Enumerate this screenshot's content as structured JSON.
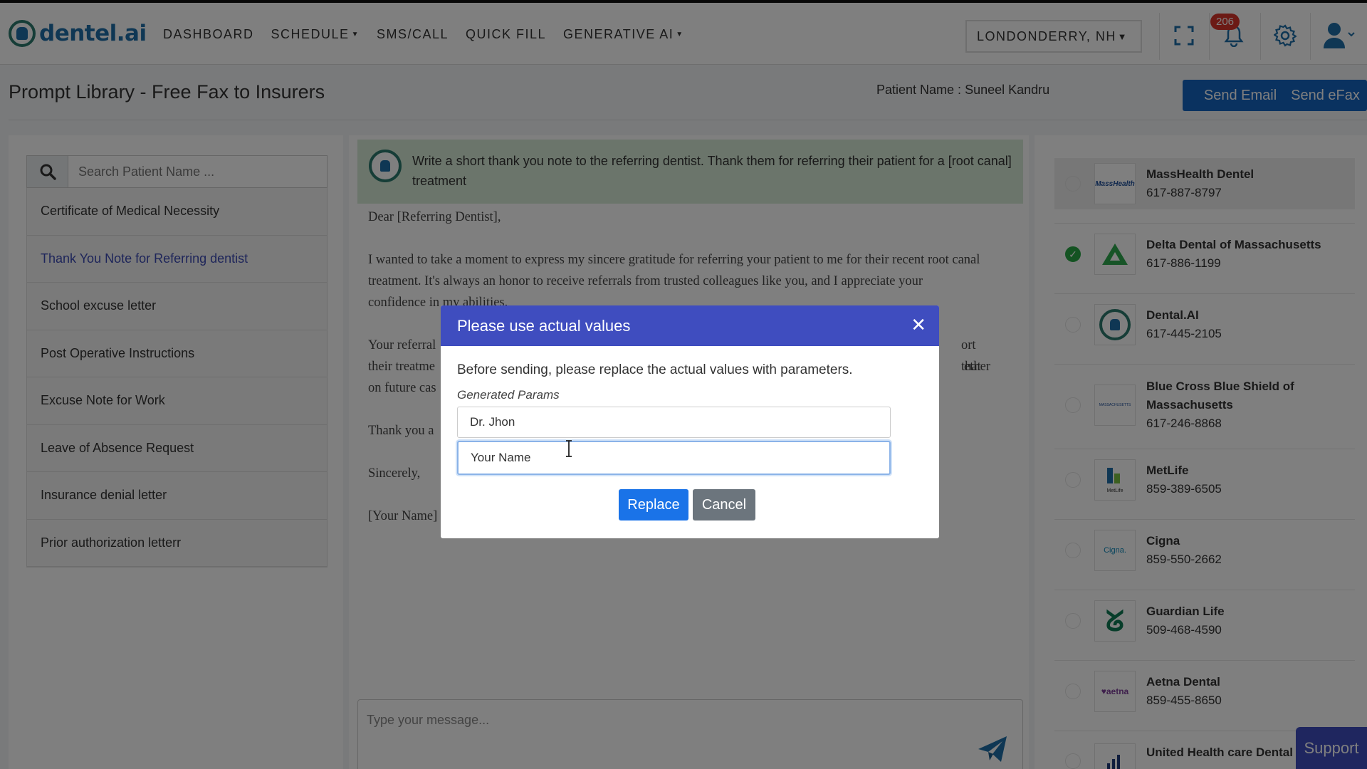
{
  "app": {
    "logo_text": "dentel.ai",
    "logo_icon": "tooth-logo-icon"
  },
  "nav": [
    {
      "label": "DASHBOARD",
      "dropdown": false
    },
    {
      "label": "SCHEDULE",
      "dropdown": true
    },
    {
      "label": "SMS/CALL",
      "dropdown": false
    },
    {
      "label": "QUICK FILL",
      "dropdown": false
    },
    {
      "label": "GENERATIVE AI",
      "dropdown": true
    }
  ],
  "header": {
    "location": "LONDONDERRY, NH",
    "notification_count": "206",
    "icons": [
      "fullscreen-icon",
      "bell-icon",
      "gear-icon",
      "user-icon"
    ]
  },
  "page": {
    "title": "Prompt Library - Free Fax to Insurers",
    "patient_label": "Patient Name :",
    "patient_name": "Suneel Kandru",
    "send_email": "Send Email",
    "send_efax": "Send eFax"
  },
  "sidebar": {
    "search_placeholder": "Search Patient Name ...",
    "items": [
      {
        "label": "Certificate of Medical Necessity",
        "active": false
      },
      {
        "label": "Thank You Note for Referring dentist",
        "active": true
      },
      {
        "label": "School excuse letter",
        "active": false
      },
      {
        "label": "Post Operative Instructions",
        "active": false
      },
      {
        "label": "Excuse Note for Work",
        "active": false
      },
      {
        "label": "Leave of Absence Request",
        "active": false
      },
      {
        "label": "Insurance denial letter",
        "active": false
      },
      {
        "label": "Prior authorization letterr",
        "active": false
      }
    ]
  },
  "center": {
    "prompt": "Write a short thank you note to the referring dentist. Thank them for referring their patient for a [root canal] treatment",
    "letter": {
      "greeting": "Dear [Referring Dentist],",
      "p1": "I wanted to take a moment to express my sincere gratitude for referring your patient to me for their recent root canal treatment. It's always an honor to receive referrals from trusted colleagues like you, and I appreciate your confidence in my abilities.",
      "p2_start": "Your referral",
      "p2_mid_right": "ort that",
      "p2_line2_start": "their treatme",
      "p2_line2_right": "ether",
      "p2_line3_start": "on future cas",
      "p3_start": "Thank you a",
      "closing": "Sincerely,",
      "signature": "[Your Name]"
    },
    "message_placeholder": "Type your message..."
  },
  "insurers": [
    {
      "name": "MassHealth Dentel",
      "phone": "617-887-8797",
      "selected": false,
      "highlight": true,
      "logo": "masshealth-logo-icon"
    },
    {
      "name": "Delta Dental of Massachusetts",
      "phone": "617-886-1199",
      "selected": true,
      "highlight": false,
      "logo": "delta-logo-icon"
    },
    {
      "name": "Dental.AI",
      "phone": "617-445-2105",
      "selected": false,
      "highlight": false,
      "logo": "tooth-logo-icon"
    },
    {
      "name": "Blue Cross Blue Shield of",
      "name2": "Massachusetts",
      "phone": "617-246-8868",
      "selected": false,
      "highlight": false,
      "logo": "bcbs-logo-icon"
    },
    {
      "name": "MetLife",
      "phone": "859-389-6505",
      "selected": false,
      "highlight": false,
      "logo": "metlife-logo-icon"
    },
    {
      "name": "Cigna",
      "phone": "859-550-2662",
      "selected": false,
      "highlight": false,
      "logo": "cigna-logo-icon"
    },
    {
      "name": "Guardian Life",
      "phone": "509-468-4590",
      "selected": false,
      "highlight": false,
      "logo": "guardian-logo-icon"
    },
    {
      "name": "Aetna Dental",
      "phone": "859-455-8650",
      "selected": false,
      "highlight": false,
      "logo": "aetna-logo-icon"
    },
    {
      "name": "United Health care Dental",
      "phone": "",
      "selected": false,
      "highlight": false,
      "logo": "united-logo-icon"
    }
  ],
  "logo_texts": {
    "masshealth": "MassHealth",
    "aetna": "♥aetna",
    "cigna": "Cigna.",
    "metlife": "MetLife",
    "bcbs": "MASSACHUSETTS"
  },
  "support_label": "Support",
  "modal": {
    "title": "Please use actual values",
    "message": "Before sending, please replace the actual values with parameters.",
    "params_label": "Generated Params",
    "param1": "Dr. Jhon",
    "param2": "Your Name",
    "replace": "Replace",
    "cancel": "Cancel"
  },
  "colors": {
    "brand": "#1f6fa8",
    "primary": "#1565c0",
    "modal_header": "#3f4dbf",
    "success": "#28a745",
    "badge": "#d9342b"
  }
}
